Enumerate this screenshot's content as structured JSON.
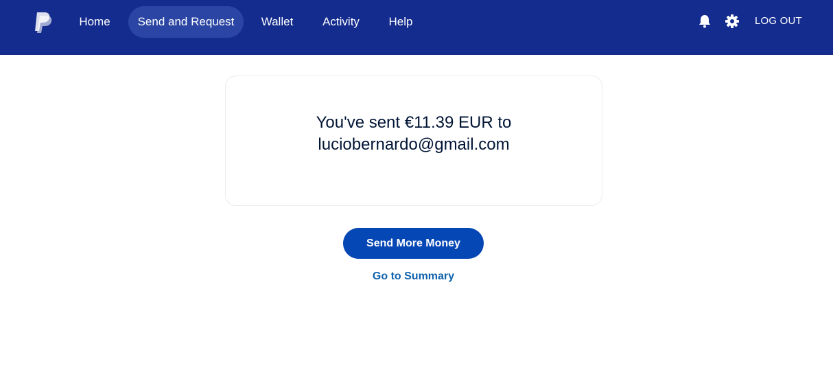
{
  "nav": {
    "brand_icon": "paypal-logo",
    "items": [
      {
        "label": "Home",
        "active": false
      },
      {
        "label": "Send and Request",
        "active": true
      },
      {
        "label": "Wallet",
        "active": false
      },
      {
        "label": "Activity",
        "active": false
      },
      {
        "label": "Help",
        "active": false
      }
    ],
    "icons": [
      "bell-icon",
      "gear-icon"
    ],
    "logout_label": "LOG OUT"
  },
  "confirmation": {
    "line1": "You've sent €11.39 EUR to",
    "line2": "luciobernardo@gmail.com"
  },
  "actions": {
    "primary_label": "Send More Money",
    "link_label": "Go to Summary"
  },
  "colors": {
    "header_bg": "#142c8e",
    "active_tab_bg": "#2a45a3",
    "primary_button": "#0547b4",
    "link": "#0f62ad",
    "text_dark": "#001435"
  }
}
